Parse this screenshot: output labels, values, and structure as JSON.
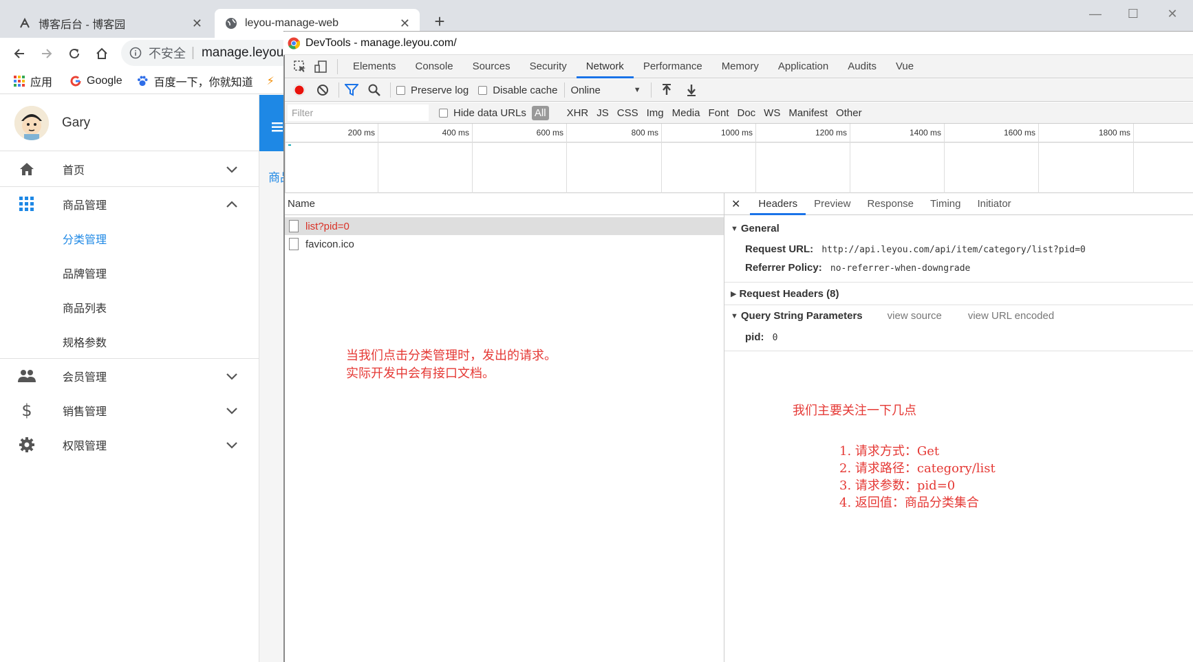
{
  "browser": {
    "tabs": [
      {
        "title": "博客后台 - 博客园",
        "icon": "blog-icon"
      },
      {
        "title": "leyou-manage-web",
        "icon": "globe-icon"
      }
    ],
    "address": {
      "security_label": "不安全",
      "url": "manage.leyou."
    },
    "bookmarks": [
      {
        "label": "应用",
        "icon": "apps-grid-icon"
      },
      {
        "label": "Google",
        "icon": "google-icon"
      },
      {
        "label": "百度一下，你就知道",
        "icon": "baidu-paw-icon"
      }
    ]
  },
  "sidebar": {
    "user": {
      "name": "Gary"
    },
    "menu": [
      {
        "label": "首页",
        "icon": "home-icon",
        "expanded": false
      },
      {
        "label": "商品管理",
        "icon": "apps-grid-icon",
        "expanded": true,
        "children": [
          "分类管理",
          "品牌管理",
          "商品列表",
          "规格参数"
        ]
      },
      {
        "label": "会员管理",
        "icon": "people-icon",
        "expanded": false
      },
      {
        "label": "销售管理",
        "icon": "dollar-icon",
        "expanded": false
      },
      {
        "label": "权限管理",
        "icon": "gear-icon",
        "expanded": false
      }
    ],
    "active_child": "分类管理"
  },
  "page": {
    "partial_text": "商品"
  },
  "devtools": {
    "title": "DevTools - manage.leyou.com/",
    "tabs": [
      "Elements",
      "Console",
      "Sources",
      "Security",
      "Network",
      "Performance",
      "Memory",
      "Application",
      "Audits",
      "Vue"
    ],
    "active_tab": "Network",
    "toolbar": {
      "preserve_log": "Preserve log",
      "disable_cache": "Disable cache",
      "throttle": "Online"
    },
    "filter": {
      "placeholder": "Filter",
      "hide_data_urls": "Hide data URLs",
      "types": [
        "All",
        "XHR",
        "JS",
        "CSS",
        "Img",
        "Media",
        "Font",
        "Doc",
        "WS",
        "Manifest",
        "Other"
      ],
      "active_type": "All"
    },
    "timeline_ticks": [
      "200 ms",
      "400 ms",
      "600 ms",
      "800 ms",
      "1000 ms",
      "1200 ms",
      "1400 ms",
      "1600 ms",
      "1800 ms"
    ],
    "requests": {
      "column": "Name",
      "rows": [
        {
          "name": "list?pid=0",
          "selected": true
        },
        {
          "name": "favicon.ico",
          "selected": false
        }
      ]
    },
    "detail": {
      "tabs": [
        "Headers",
        "Preview",
        "Response",
        "Timing",
        "Initiator"
      ],
      "active_tab": "Headers",
      "general": {
        "title": "General",
        "request_url_key": "Request URL:",
        "request_url": "http://api.leyou.com/api/item/category/list?pid=0",
        "referrer_key": "Referrer Policy:",
        "referrer": "no-referrer-when-downgrade"
      },
      "request_headers": "Request Headers (8)",
      "query": {
        "title": "Query String Parameters",
        "view_source": "view source",
        "view_encoded": "view URL encoded",
        "param_key": "pid:",
        "param_value": "0"
      }
    }
  },
  "annotations": {
    "left": [
      "当我们点击分类管理时，发出的请求。",
      "实际开发中会有接口文档。"
    ],
    "right_title": "我们主要关注一下几点",
    "right_items": [
      "1. 请求方式：Get",
      "2. 请求路径：category/list",
      "3. 请求参数：pid=0",
      "4. 返回值：商品分类集合"
    ]
  },
  "colors": {
    "accent": "#1a73e8",
    "annotation": "#e53935",
    "selected_request": "#d93025",
    "app_primary": "#1e88e5"
  }
}
